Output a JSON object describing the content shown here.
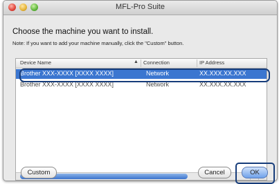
{
  "window": {
    "title": "MFL-Pro Suite"
  },
  "heading": "Choose the machine you want to install.",
  "note": "Note: If you want to add your machine manually, click the \"Custom\" button.",
  "table": {
    "columns": [
      "Device Name",
      "Connection",
      "IP Address"
    ],
    "sort_indicator": "▲",
    "rows": [
      {
        "device_name": "Brother XXX-XXXX [XXXX XXXX]",
        "connection": "Network",
        "ip_address": "XX.XXX.XX.XXX",
        "selected": true
      },
      {
        "device_name": "Brother XXX-XXXX [XXXX XXXX]",
        "connection": "Network",
        "ip_address": "XX.XXX.XX.XXX",
        "selected": false
      }
    ]
  },
  "buttons": {
    "custom": "Custom",
    "cancel": "Cancel",
    "ok": "OK"
  },
  "icons": {
    "close": "close-light-icon",
    "minimize": "minimize-light-icon",
    "zoom": "zoom-light-icon",
    "scroll_left": "◂",
    "scroll_right": "▸"
  },
  "colors": {
    "selection": "#3b76d0",
    "highlight_outline": "#163c7a",
    "default_button": "#6ea1ea"
  }
}
